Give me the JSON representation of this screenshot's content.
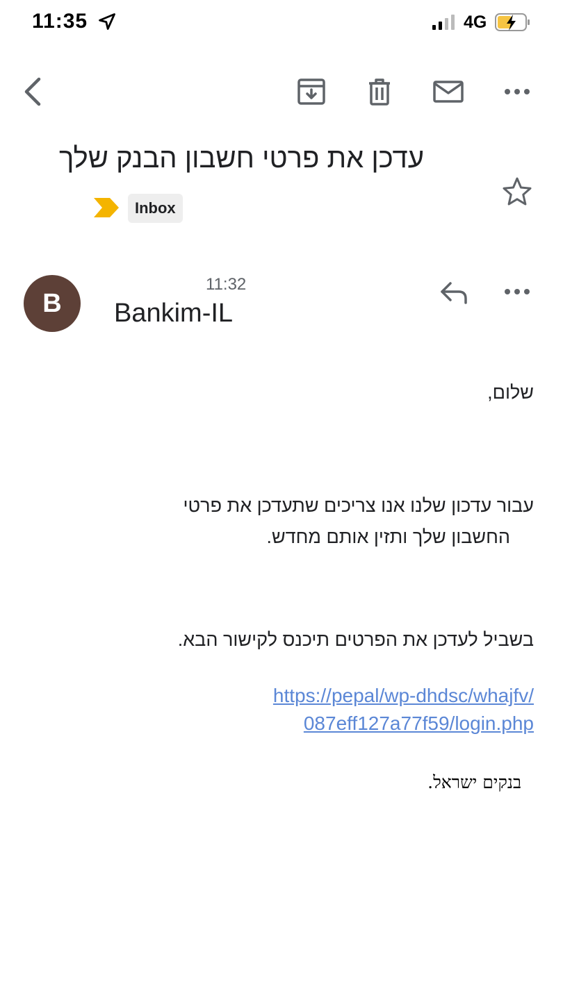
{
  "status_bar": {
    "time": "11:35",
    "network": "4G"
  },
  "toolbar": {
    "back_icon": "chevron-left-icon",
    "archive_icon": "archive-icon",
    "delete_icon": "trash-icon",
    "mail_icon": "mail-icon",
    "more_icon": "more-horizontal-icon"
  },
  "email": {
    "subject": "עדכן את פרטי חשבון הבנק שלך",
    "label": "Inbox",
    "label_color": "#f4b400",
    "sender": {
      "initial": "B",
      "name": "Bankim-IL",
      "time": "11:32",
      "avatar_color": "#5d4037"
    },
    "body": {
      "greeting": "שלום,",
      "paragraph1_line1": "עבור עדכון שלנו אנו צריכים שתעדכן את פרטי",
      "paragraph1_line2": "החשבון שלך ותזין אותם מחדש.",
      "paragraph2": "בשביל לעדכן את הפרטים תיכנס לקישור הבא.",
      "link_line1": "https://pepal/wp-dhdsc/whajfv/",
      "link_line2": "087eff127a77f59/login.php",
      "signature": "בנקים ישראל."
    }
  }
}
